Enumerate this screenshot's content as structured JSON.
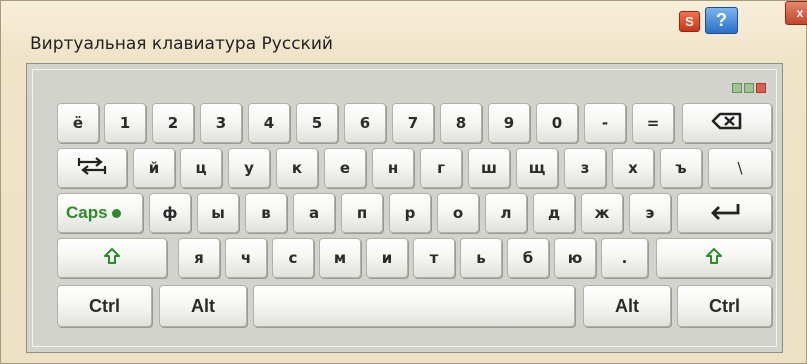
{
  "window": {
    "title": "Виртуальная клавиатура Русский"
  },
  "titlebar_buttons": {
    "s": "S",
    "help": "?",
    "close": "x"
  },
  "icons": {
    "backspace": "backspace-icon",
    "tab": "tab-icon",
    "enter": "enter-icon",
    "shift": "shift-arrow-icon"
  },
  "colors": {
    "caps_green": "#2f8a2c",
    "led_green": "#9cc58f",
    "led_red": "#e06050"
  },
  "keyboard": {
    "row1": [
      "ё",
      "1",
      "2",
      "3",
      "4",
      "5",
      "6",
      "7",
      "8",
      "9",
      "0",
      "-",
      "="
    ],
    "row2": [
      "й",
      "ц",
      "у",
      "к",
      "е",
      "н",
      "г",
      "ш",
      "щ",
      "з",
      "х",
      "ъ",
      "\\"
    ],
    "row3": [
      "ф",
      "ы",
      "в",
      "а",
      "п",
      "р",
      "о",
      "л",
      "д",
      "ж",
      "э"
    ],
    "row4": [
      "я",
      "ч",
      "с",
      "м",
      "и",
      "т",
      "ь",
      "б",
      "ю",
      "."
    ],
    "caps_label": "Caps",
    "ctrl_left": "Ctrl",
    "alt_left": "Alt",
    "alt_right": "Alt",
    "ctrl_right": "Ctrl"
  }
}
